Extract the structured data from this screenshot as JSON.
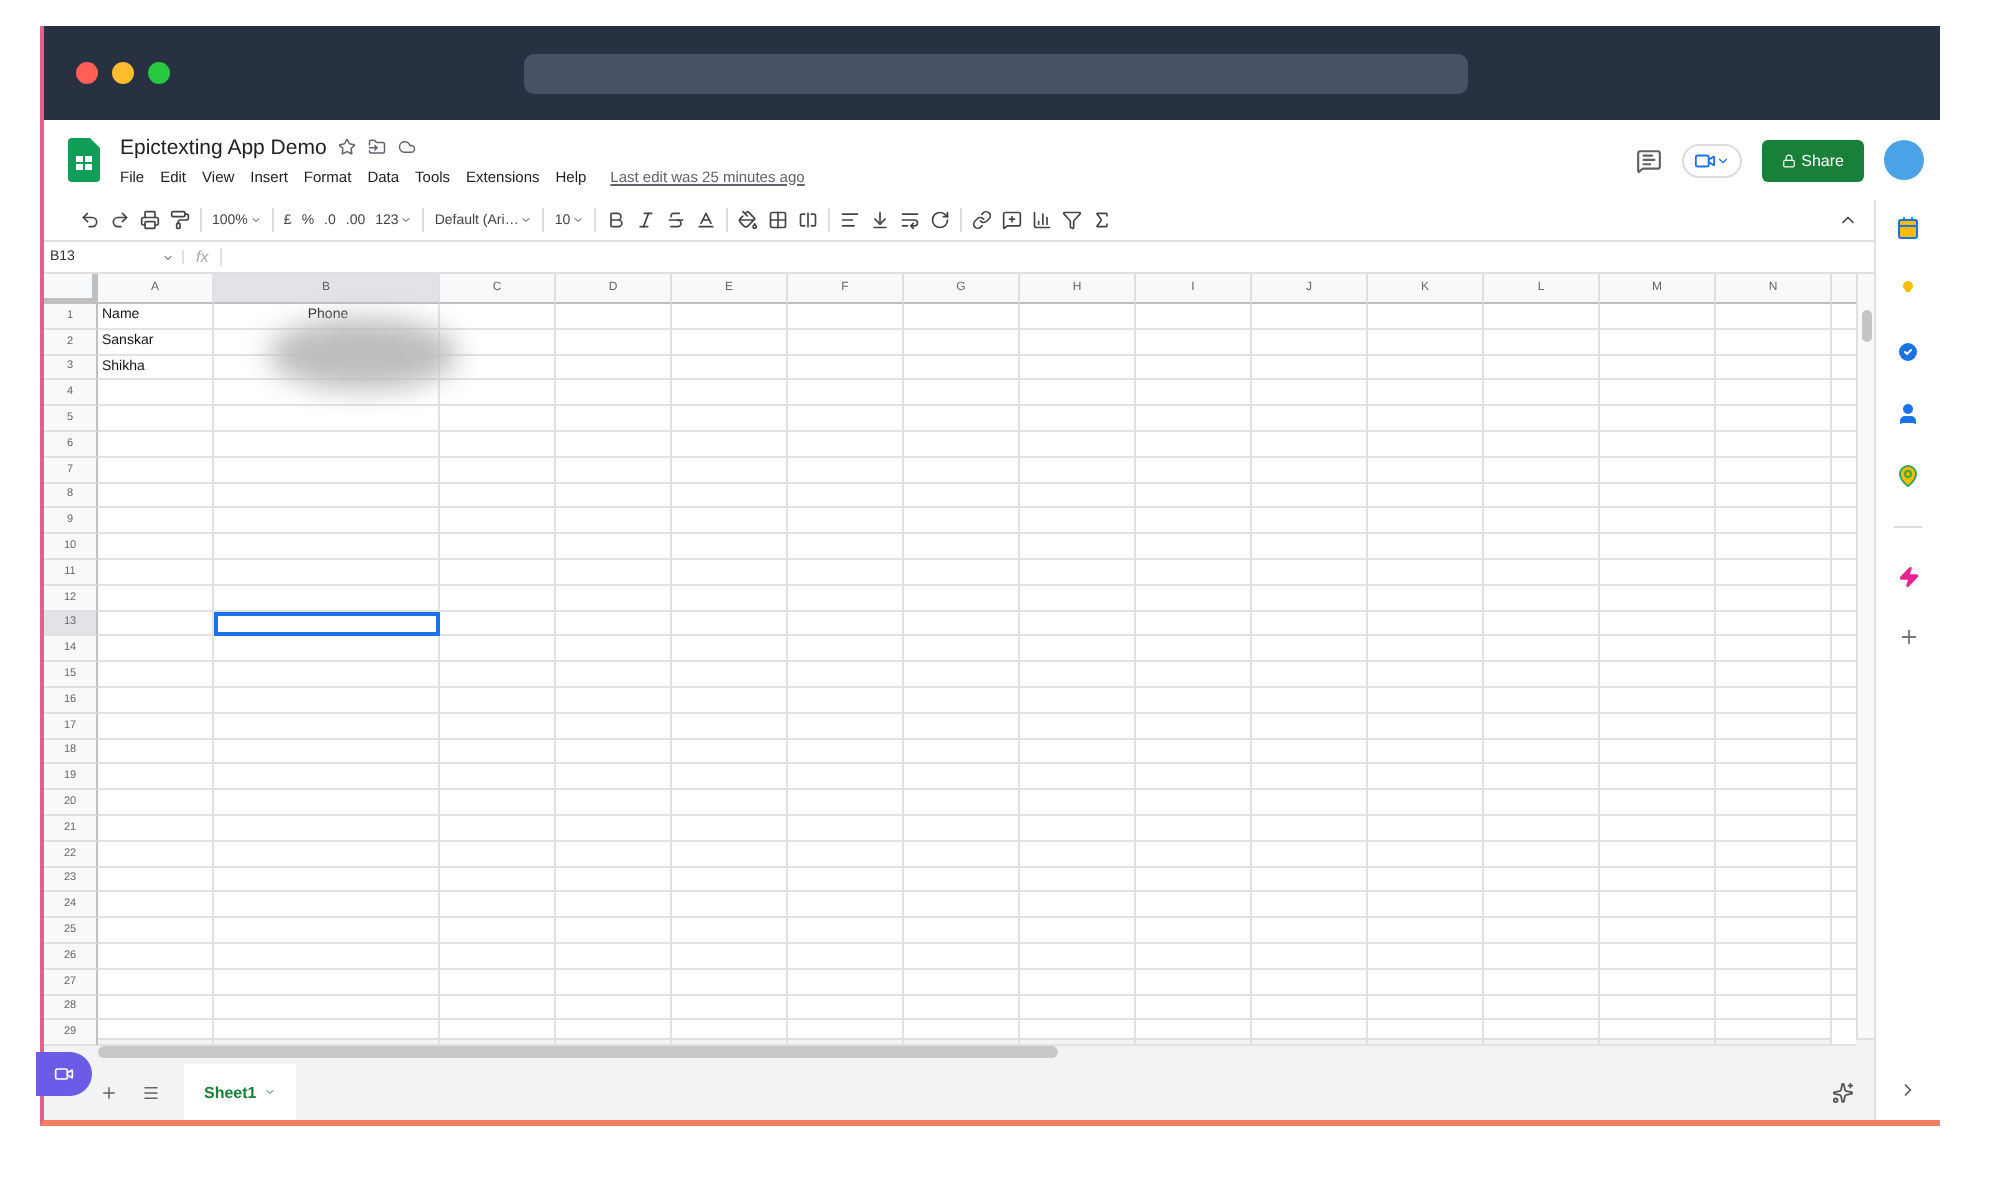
{
  "header": {
    "title": "Epictexting App Demo",
    "menus": [
      "File",
      "Edit",
      "View",
      "Insert",
      "Format",
      "Data",
      "Tools",
      "Extensions",
      "Help"
    ],
    "last_edit": "Last edit was 25 minutes ago",
    "share": "Share"
  },
  "toolbar": {
    "zoom": "100%",
    "currency": "£",
    "percent": "%",
    "decrease_decimals": ".0",
    "increase_decimals": ".00",
    "number_format": "123",
    "font": "Default (Ari…",
    "font_size": "10"
  },
  "formula_bar": {
    "cell_ref": "B13",
    "fx": "fx"
  },
  "grid": {
    "columns": [
      {
        "label": "A",
        "selected": false
      },
      {
        "label": "B",
        "selected": true
      },
      {
        "label": "C",
        "selected": false
      },
      {
        "label": "D",
        "selected": false
      },
      {
        "label": "E",
        "selected": false
      },
      {
        "label": "F",
        "selected": false
      },
      {
        "label": "G",
        "selected": false
      },
      {
        "label": "H",
        "selected": false
      },
      {
        "label": "I",
        "selected": false
      },
      {
        "label": "J",
        "selected": false
      },
      {
        "label": "K",
        "selected": false
      },
      {
        "label": "L",
        "selected": false
      },
      {
        "label": "M",
        "selected": false
      },
      {
        "label": "N",
        "selected": false
      }
    ],
    "rows": [
      {
        "label": "1",
        "selected": false,
        "cells": [
          "Name",
          "Phone"
        ]
      },
      {
        "label": "2",
        "selected": false,
        "cells": [
          "Sanskar"
        ]
      },
      {
        "label": "3",
        "selected": false,
        "cells": [
          "Shikha"
        ]
      },
      {
        "label": "4",
        "selected": false
      },
      {
        "label": "5",
        "selected": false
      },
      {
        "label": "6",
        "selected": false
      },
      {
        "label": "7",
        "selected": false
      },
      {
        "label": "8",
        "selected": false
      },
      {
        "label": "9",
        "selected": false
      },
      {
        "label": "10",
        "selected": false
      },
      {
        "label": "11",
        "selected": false
      },
      {
        "label": "12",
        "selected": false
      },
      {
        "label": "13",
        "selected": true
      },
      {
        "label": "14",
        "selected": false
      },
      {
        "label": "15",
        "selected": false
      },
      {
        "label": "16",
        "selected": false
      },
      {
        "label": "17",
        "selected": false
      },
      {
        "label": "18",
        "selected": false
      },
      {
        "label": "19",
        "selected": false
      },
      {
        "label": "20",
        "selected": false
      },
      {
        "label": "21",
        "selected": false
      },
      {
        "label": "22",
        "selected": false
      },
      {
        "label": "23",
        "selected": false
      },
      {
        "label": "24",
        "selected": false
      },
      {
        "label": "25",
        "selected": false
      },
      {
        "label": "26",
        "selected": false
      },
      {
        "label": "27",
        "selected": false
      },
      {
        "label": "28",
        "selected": false
      },
      {
        "label": "29",
        "selected": false
      }
    ]
  },
  "sheet_tabs": [
    {
      "label": "Sheet1",
      "selected": true
    }
  ]
}
